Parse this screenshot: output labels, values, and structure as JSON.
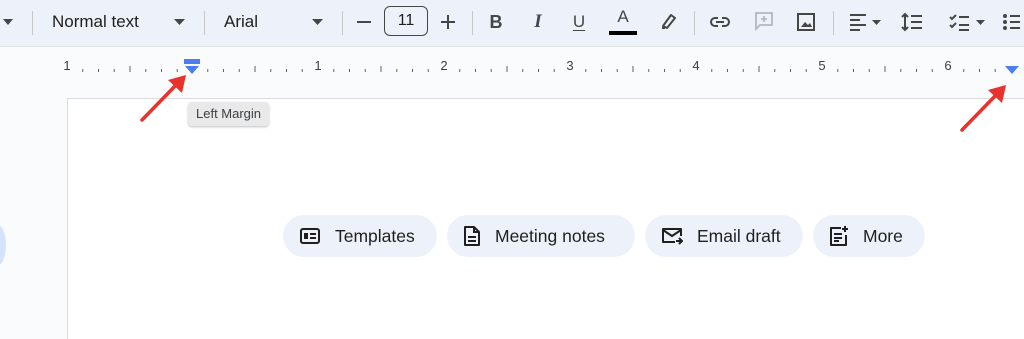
{
  "toolbar": {
    "style_select": "Normal text",
    "font_select": "Arial",
    "font_size": "11",
    "text_color_glyph": "A",
    "bold_glyph": "B",
    "italic_glyph": "I",
    "underline_glyph": "U"
  },
  "ruler": {
    "labels": [
      "1",
      "1",
      "2",
      "3",
      "4",
      "5",
      "6"
    ],
    "marker_color": "#4a7df0"
  },
  "tooltip": {
    "text": "Left Margin"
  },
  "chips": [
    {
      "label": "Templates",
      "icon": "templates-icon"
    },
    {
      "label": "Meeting notes",
      "icon": "document-icon"
    },
    {
      "label": "Email draft",
      "icon": "email-icon"
    },
    {
      "label": "More",
      "icon": "note-add-icon"
    }
  ],
  "colors": {
    "toolbar_bg": "#edf2fa",
    "chip_bg": "#edf2fa",
    "annotation_arrow": "#e8322b",
    "text_color_bar": "#000000"
  }
}
